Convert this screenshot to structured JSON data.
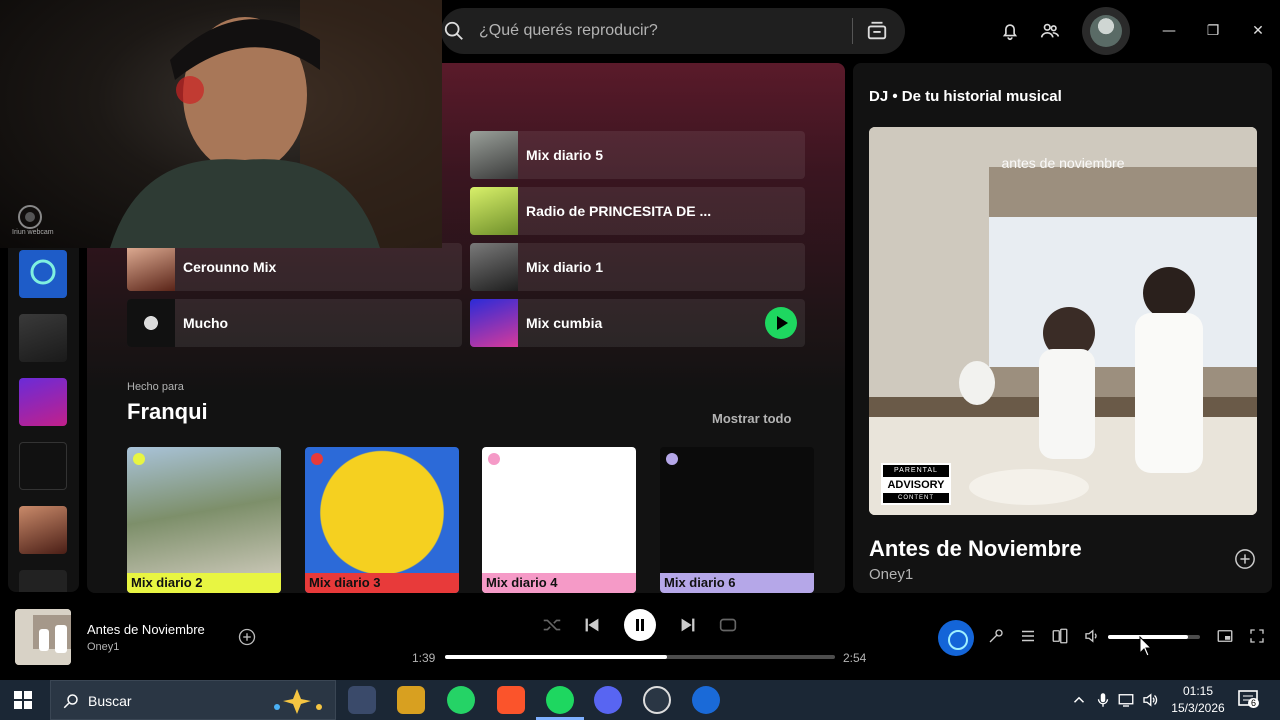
{
  "search": {
    "placeholder": "¿Qué querés reproducir?"
  },
  "webcam": {
    "label": "Iriun webcam"
  },
  "quick_tiles": [
    {
      "label": "Mix diario 5",
      "icon": "mix-diario-5-cover"
    },
    {
      "label": "Radio de PRINCESITA DE ...",
      "icon": "radio-princesita-cover"
    },
    {
      "label": "Cerounno Mix",
      "icon": "cerounno-mix-cover"
    },
    {
      "label": "Mix diario 1",
      "icon": "mix-diario-1-cover"
    },
    {
      "label": "Mucho",
      "icon": "mucho-cover"
    },
    {
      "label": "Mix cumbia",
      "icon": "mix-cumbia-cover"
    }
  ],
  "made_for": {
    "subtitle": "Hecho para",
    "title": "Franqui",
    "show_all": "Mostrar todo",
    "cards": [
      {
        "label": "Mix diario 2",
        "strip_color": "#e8f542"
      },
      {
        "label": "Mix diario 3",
        "strip_color": "#e83a3a"
      },
      {
        "label": "Mix diario 4",
        "strip_color": "#f59ac7"
      },
      {
        "label": "Mix diario 6",
        "strip_color": "#b5a7e8"
      }
    ]
  },
  "now_playing_view": {
    "header": "DJ • De tu historial musical",
    "art_text": "antes de noviembre",
    "advisory": {
      "line1": "PARENTAL",
      "line2": "ADVISORY",
      "line3": "CONTENT"
    },
    "song": "Antes de Noviembre",
    "artist": "Oney1"
  },
  "player": {
    "title": "Antes de Noviembre",
    "artist": "Oney1",
    "elapsed": "1:39",
    "duration": "2:54",
    "progress": 0.57,
    "volume": 0.87
  },
  "taskbar": {
    "search_label": "Buscar",
    "time": "01:15",
    "date": "15/3/2026",
    "notifications": "6"
  },
  "colors": {
    "accent": "#1ed760",
    "dj": "#1465d8"
  }
}
